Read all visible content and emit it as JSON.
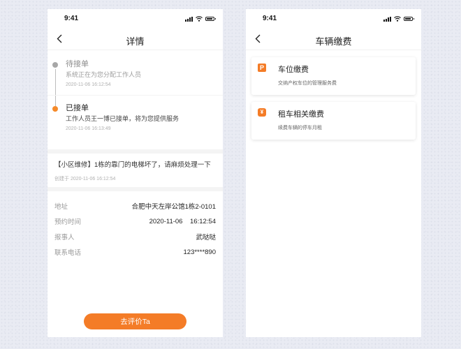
{
  "left": {
    "status": {
      "time": "9:41"
    },
    "nav": {
      "title": "详情"
    },
    "timeline": [
      {
        "title": "待接单",
        "desc": "系统正在为您分配工作人员",
        "time": "2020-11-06  16:12:54"
      },
      {
        "title": "已接单",
        "desc": "工作人员王一博已接单，将为您提供服务",
        "time": "2020-11-06  16:13:49"
      }
    ],
    "order": {
      "text": "【小区维修】1栋的靠门的电梯坏了，请麻烦处理一下",
      "time": "创建于 2020-11-06  16:12:54"
    },
    "info": [
      {
        "label": "地址",
        "value": "合肥中天左岸公馆1栋2-0101"
      },
      {
        "label": "预约时间",
        "value": "2020-11-06    16:12:54"
      },
      {
        "label": "报事人",
        "value": "武哒哒"
      },
      {
        "label": "联系电话",
        "value": "123****890"
      }
    ],
    "rate_button": "去评价Ta"
  },
  "right": {
    "status": {
      "time": "9:41"
    },
    "nav": {
      "title": "车辆缴费"
    },
    "cards": [
      {
        "icon": "P",
        "title": "车位缴费",
        "desc": "交纳产权车位的管理服务费"
      },
      {
        "icon": "¥",
        "title": "租车相关缴费",
        "desc": "续费车辆的停车月租"
      }
    ]
  },
  "colors": {
    "accent": "#f47c27",
    "pending": "#a7a7a7"
  },
  "icons": [
    "back-arrow-icon",
    "signal-icon",
    "wifi-icon",
    "battery-icon",
    "parking-icon",
    "yen-icon"
  ]
}
